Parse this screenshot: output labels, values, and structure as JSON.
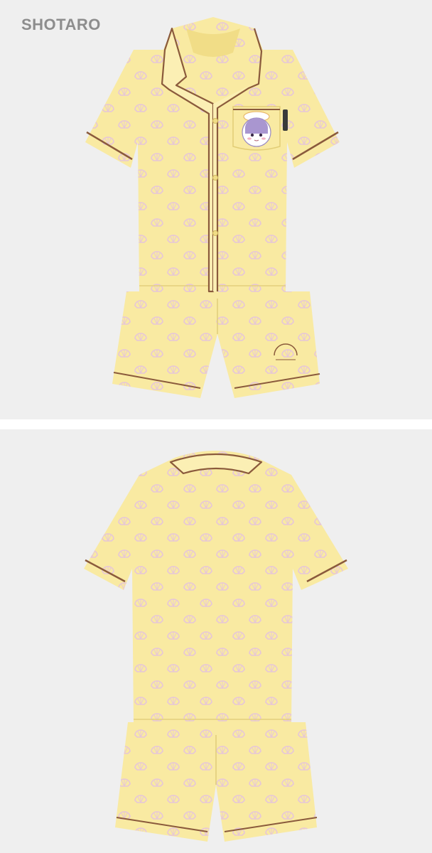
{
  "member_name": "SHOTARO",
  "product": {
    "views": [
      "front",
      "back"
    ],
    "colors": {
      "fabric": "#f9eaa2",
      "fabric_shadow": "#f1dd87",
      "piping": "#8a5a3c",
      "shell_print": "#e6c6d8",
      "background": "#efefef"
    },
    "print_motif": "shell-icon",
    "front_features": [
      "notch-collar",
      "button-placket",
      "chest-pocket",
      "character-patch",
      "woven-label",
      "shorts-embroidery"
    ],
    "back_features": [
      "camp-collar",
      "short-sleeves",
      "elastic-shorts"
    ]
  }
}
